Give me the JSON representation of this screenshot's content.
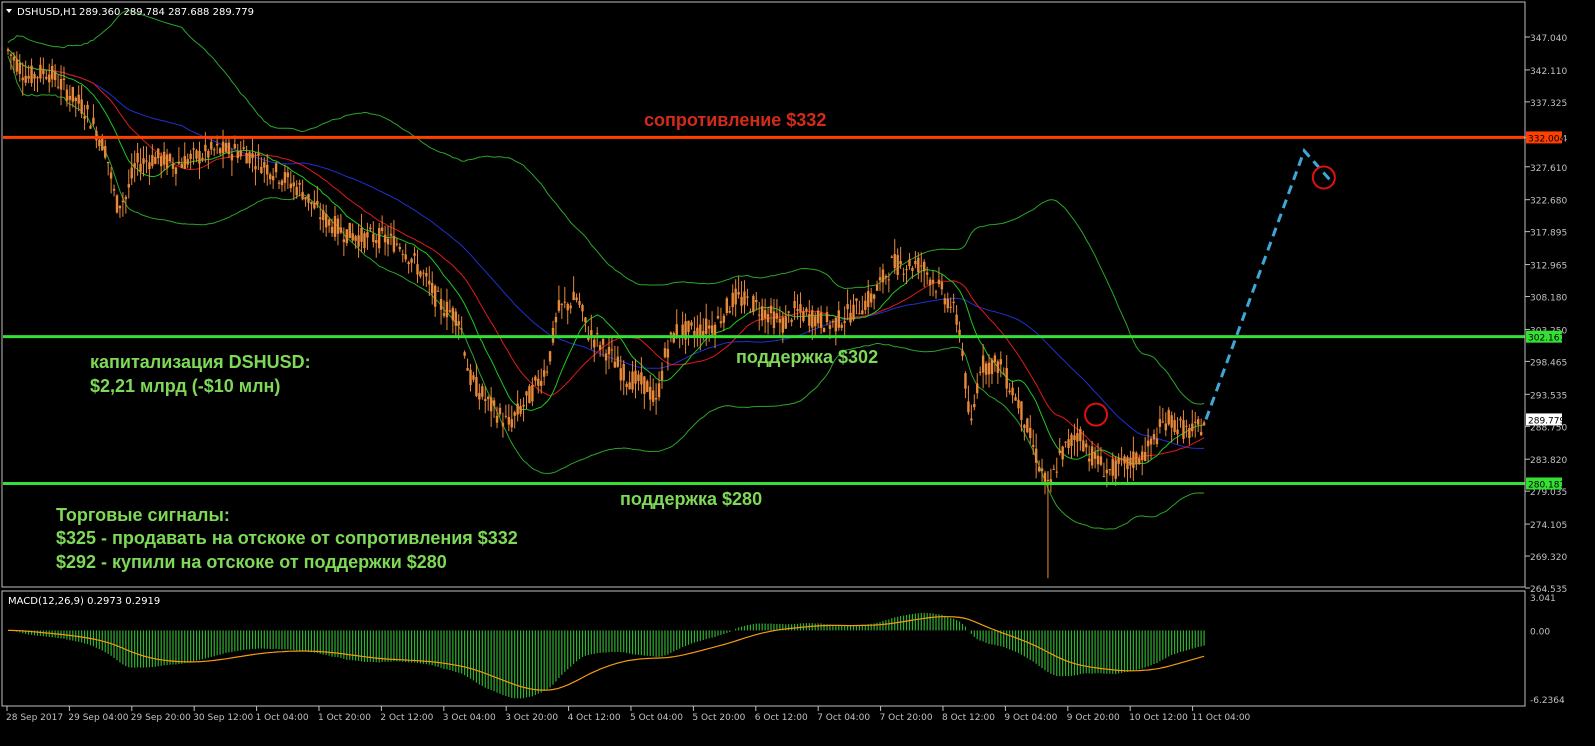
{
  "header": {
    "symbol_label": "DSHUSD,H1",
    "ohlc_text": "289.360 289.784 287.688 289.779"
  },
  "macd_label": "MACD(12,26,9) 0.2973 0.2919",
  "annotations": {
    "resistance_label": "сопротивление $332",
    "support_302_label": "поддержка $302",
    "support_280_label": "поддержка $280",
    "cap_line1": "капитализация DSHUSD:",
    "cap_line2": "$2,21 млрд (-$10 млн)",
    "signals_title": "Торговые сигналы:",
    "signal_sell": "$325 - продавать на отскоке от сопротивления $332",
    "signal_buy": "$292 - купили на отскоке от поддержки $280"
  },
  "colors": {
    "background": "#000000",
    "axis": "#c0c0c0",
    "candle": "#e8893a",
    "resistance": "#ff4000",
    "support": "#33e033",
    "resistance_text": "#d42a1a",
    "annotation_text": "#7ed957",
    "forecast": "#3fa7d6",
    "bollinger": "#2aa52a",
    "ma_fast": "#e01a1a",
    "ma_mid": "#1ec81e",
    "ma_slow": "#2030d0",
    "macd_hist": "#30b030",
    "macd_signal": "#f39a12",
    "price_tag_text": "#000000",
    "circle": "#e01010"
  },
  "chart_data": {
    "type": "candlestick",
    "symbol": "DSHUSD",
    "timeframe": "H1",
    "price_axis_ticks": [
      "347.040",
      "342.110",
      "337.325",
      "332.004",
      "327.610",
      "322.680",
      "317.895",
      "312.965",
      "308.180",
      "303.250",
      "298.465",
      "293.535",
      "288.750",
      "283.820",
      "279.035",
      "274.105",
      "269.320",
      "264.535"
    ],
    "price_range": [
      264.535,
      347.04
    ],
    "time_axis_labels": [
      "28 Sep 2017",
      "29 Sep 04:00",
      "29 Sep 20:00",
      "30 Sep 12:00",
      "1 Oct 04:00",
      "1 Oct 20:00",
      "2 Oct 12:00",
      "3 Oct 04:00",
      "3 Oct 20:00",
      "4 Oct 12:00",
      "5 Oct 04:00",
      "5 Oct 20:00",
      "6 Oct 12:00",
      "7 Oct 04:00",
      "7 Oct 20:00",
      "8 Oct 12:00",
      "9 Oct 04:00",
      "9 Oct 20:00",
      "10 Oct 12:00",
      "11 Oct 04:00"
    ],
    "approx_close_path": [
      [
        0,
        345
      ],
      [
        2,
        341
      ],
      [
        4,
        342
      ],
      [
        6,
        339
      ],
      [
        8,
        336
      ],
      [
        10,
        330
      ],
      [
        11,
        322
      ],
      [
        12,
        323
      ],
      [
        13,
        328
      ],
      [
        15,
        329
      ],
      [
        17,
        328
      ],
      [
        19,
        329
      ],
      [
        21,
        330
      ],
      [
        24,
        330
      ],
      [
        26,
        328
      ],
      [
        28,
        326
      ],
      [
        30,
        324
      ],
      [
        32,
        320
      ],
      [
        34,
        318
      ],
      [
        36,
        317
      ],
      [
        38,
        317
      ],
      [
        40,
        316
      ],
      [
        42,
        312
      ],
      [
        44,
        307
      ],
      [
        46,
        305
      ],
      [
        47,
        296
      ],
      [
        49,
        292
      ],
      [
        51,
        289
      ],
      [
        53,
        293
      ],
      [
        55,
        298
      ],
      [
        56,
        306
      ],
      [
        58,
        308
      ],
      [
        59,
        303
      ],
      [
        61,
        300
      ],
      [
        63,
        296
      ],
      [
        65,
        295
      ],
      [
        66,
        292
      ],
      [
        67,
        300
      ],
      [
        68,
        303
      ],
      [
        70,
        303
      ],
      [
        72,
        304
      ],
      [
        74,
        308
      ],
      [
        76,
        307
      ],
      [
        78,
        305
      ],
      [
        79,
        304
      ],
      [
        80,
        306
      ],
      [
        82,
        305
      ],
      [
        84,
        304
      ],
      [
        86,
        306
      ],
      [
        88,
        308
      ],
      [
        90,
        313
      ],
      [
        92,
        313
      ],
      [
        93,
        313
      ],
      [
        94,
        311
      ],
      [
        96,
        307
      ],
      [
        97,
        303
      ],
      [
        98,
        288
      ],
      [
        99,
        298
      ],
      [
        101,
        298
      ],
      [
        103,
        292
      ],
      [
        105,
        283
      ],
      [
        106,
        279
      ],
      [
        107,
        284
      ],
      [
        109,
        288
      ],
      [
        110,
        285
      ],
      [
        112,
        282
      ],
      [
        114,
        283
      ],
      [
        116,
        285
      ],
      [
        118,
        290
      ],
      [
        120,
        288
      ],
      [
        121,
        288
      ],
      [
        122,
        289.779
      ]
    ],
    "current_price": 289.779,
    "levels": [
      {
        "name": "сопротивление $332",
        "price": 332.004
      },
      {
        "name": "поддержка $302",
        "price": 302.167
      },
      {
        "name": "поддержка $280",
        "price": 280.187
      }
    ],
    "forecast_path": [
      [
        122,
        289.779
      ],
      [
        132,
        330
      ],
      [
        135,
        325
      ]
    ],
    "markers": [
      {
        "bar": 110.8,
        "price": 290.5
      },
      {
        "bar": 134,
        "price": 326
      }
    ],
    "macd": {
      "params": "12,26,9",
      "main": 0.2973,
      "signal_value": 0.2919,
      "axis_ticks": [
        "3.041",
        "0.00",
        "-6.2364"
      ],
      "range": [
        -6.2364,
        3.041
      ]
    }
  }
}
